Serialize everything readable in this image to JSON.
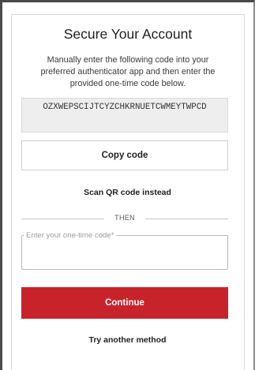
{
  "title": "Secure Your Account",
  "description": "Manually enter the following code into your preferred authenticator app and then enter the provided one-time code below.",
  "secret_code": "OZXWEPSCIJTCYZCHKRNUETCWMEYTWPCD",
  "copy_button": "Copy code",
  "scan_link": "Scan QR code instead",
  "divider_text": "THEN",
  "otp_field": {
    "label": "Enter your one-time code*",
    "value": ""
  },
  "continue_button": "Continue",
  "alternate_link": "Try another method",
  "colors": {
    "primary": "#c8232b",
    "code_bg": "#eeeeee"
  }
}
